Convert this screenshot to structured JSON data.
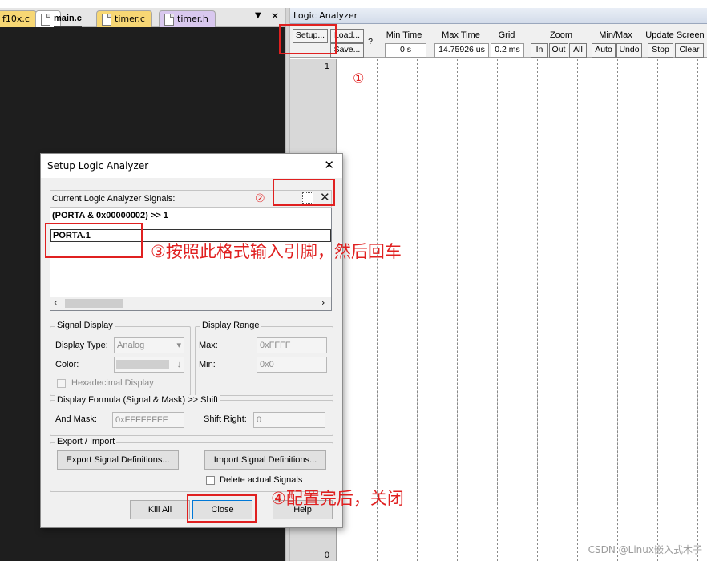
{
  "tabs": [
    {
      "label": "f10x.c"
    },
    {
      "label": "main.c"
    },
    {
      "label": "timer.c"
    },
    {
      "label": "timer.h"
    }
  ],
  "tab_controls": {
    "dropdown": "▼",
    "close": "✕"
  },
  "logic_analyzer": {
    "title": "Logic Analyzer",
    "buttons": {
      "setup": "Setup...",
      "load": "Load...",
      "save": "Save...",
      "help": "?"
    },
    "min_time": {
      "label": "Min Time",
      "value": "0 s"
    },
    "max_time": {
      "label": "Max Time",
      "value": "14.75926 us"
    },
    "grid": {
      "label": "Grid",
      "value": "0.2 ms"
    },
    "zoom": {
      "label": "Zoom",
      "in": "In",
      "out": "Out",
      "all": "All"
    },
    "minmax": {
      "label": "Min/Max",
      "auto": "Auto",
      "undo": "Undo"
    },
    "update_screen": {
      "label": "Update Screen",
      "stop": "Stop",
      "clear": "Clear"
    },
    "axis_top": "1",
    "axis_bottom": "0"
  },
  "dialog": {
    "title": "Setup Logic Analyzer",
    "close": "✕",
    "signals_label": "Current Logic Analyzer Signals:",
    "signals": [
      "(PORTA & 0x00000002) >> 1",
      "PORTA.1"
    ],
    "signal_display": {
      "group": "Signal Display",
      "display_type_label": "Display Type:",
      "display_type_value": "Analog",
      "color_label": "Color:",
      "hex_label": "Hexadecimal Display"
    },
    "display_range": {
      "group": "Display Range",
      "max_label": "Max:",
      "max_value": "0xFFFF",
      "min_label": "Min:",
      "min_value": "0x0"
    },
    "formula": {
      "group": "Display Formula (Signal & Mask) >> Shift",
      "and_mask_label": "And Mask:",
      "and_mask_value": "0xFFFFFFFF",
      "shift_label": "Shift Right:",
      "shift_value": "0"
    },
    "export_import": {
      "group": "Export / Import",
      "export_btn": "Export Signal Definitions...",
      "import_btn": "Import Signal Definitions...",
      "delete_label": "Delete actual Signals"
    },
    "buttons": {
      "kill_all": "Kill All",
      "close": "Close",
      "help": "Help"
    }
  },
  "annotations": {
    "a1": "①",
    "a2": "②",
    "a3": "③按照此格式输入引脚，然后回车",
    "a4": "④配置完后，关闭"
  },
  "watermark": "CSDN @Linux嵌入式木子",
  "colors": {
    "annotation": "#e02020",
    "editor_bg": "#1e1e1e",
    "tab_c": "#f7d774",
    "tab_h": "#d9c8ef"
  }
}
